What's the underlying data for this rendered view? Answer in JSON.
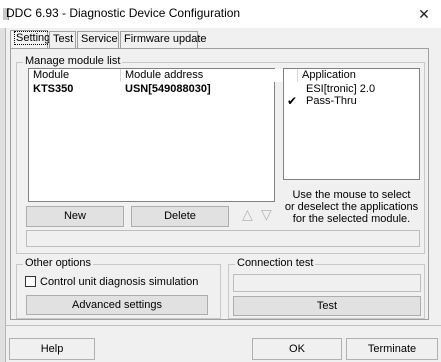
{
  "window": {
    "title": "DDC 6.93 - Diagnostic Device Configuration",
    "close_glyph": "✕"
  },
  "tabs": [
    {
      "label": "Settings"
    },
    {
      "label": "Test"
    },
    {
      "label": "Service"
    },
    {
      "label": "Firmware update"
    }
  ],
  "manage": {
    "legend": "Manage module list",
    "columns": [
      "Module",
      "Module address"
    ],
    "rows": [
      {
        "module": "KTS350",
        "address": "USN[549088030]"
      }
    ],
    "buttons": {
      "new": "New",
      "delete": "Delete"
    },
    "arrows": {
      "up": "△",
      "down": "▽"
    }
  },
  "applications": {
    "header": "Application",
    "items": [
      {
        "name": "ESI[tronic] 2.0",
        "checked": false
      },
      {
        "name": "Pass-Thru",
        "checked": true
      }
    ],
    "check_glyph": "✔",
    "hint_lines": [
      "Use the mouse to select",
      "or deselect the applications",
      "for the selected module."
    ]
  },
  "other_options": {
    "legend": "Other options",
    "checkbox_label": "Control unit diagnosis simulation",
    "checkbox_checked": false,
    "advanced_button": "Advanced settings"
  },
  "connection_test": {
    "legend": "Connection test",
    "test_button": "Test"
  },
  "footer": {
    "help": "Help",
    "ok": "OK",
    "terminate": "Terminate"
  }
}
